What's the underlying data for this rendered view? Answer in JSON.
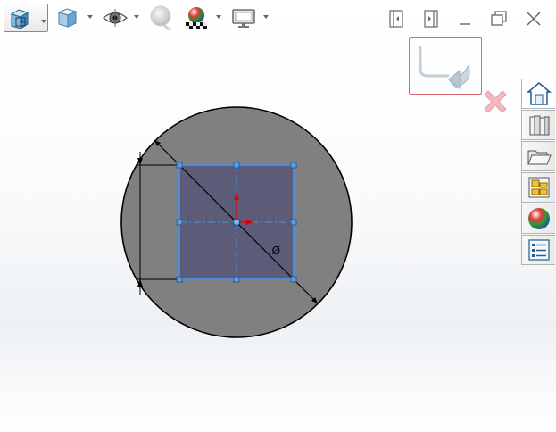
{
  "toolbar": {
    "items": [
      {
        "icon": "view-orientation-icon",
        "has_dropdown": true
      },
      {
        "icon": "display-style-icon",
        "has_dropdown": true
      },
      {
        "icon": "hide-show-items-icon",
        "has_dropdown": true
      },
      {
        "icon": "edit-appearance-icon",
        "has_dropdown": false
      },
      {
        "icon": "apply-scene-icon",
        "has_dropdown": true
      },
      {
        "icon": "view-settings-icon",
        "has_dropdown": true
      }
    ]
  },
  "window_controls": [
    "restore-left-icon",
    "restore-right-icon",
    "minimize-icon",
    "maximize-icon",
    "close-icon"
  ],
  "confirmation_corner": {
    "ok_icon": "exit-sketch-icon",
    "cancel_icon": "cancel-icon",
    "highlight_color": "#e06671"
  },
  "sketch": {
    "circle_fill": "#808080",
    "rectangle_fill": "#5c5c78",
    "selection_color": "#4a90e2",
    "diameter_symbol": "Ø",
    "dimension_value": "",
    "vertical_dimension_text": ""
  },
  "task_pane": {
    "tabs": [
      {
        "icon": "solidworks-resources-icon",
        "active": true
      },
      {
        "icon": "design-library-icon",
        "active": false
      },
      {
        "icon": "file-explorer-icon",
        "active": false
      },
      {
        "icon": "view-palette-icon",
        "active": false
      },
      {
        "icon": "appearances-scenes-icon",
        "active": false
      },
      {
        "icon": "custom-properties-icon",
        "active": false
      }
    ]
  }
}
